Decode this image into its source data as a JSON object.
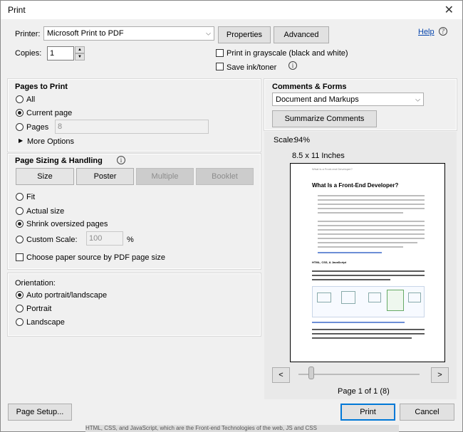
{
  "window": {
    "title": "Print",
    "close_glyph": "✕"
  },
  "printer": {
    "label": "Printer:",
    "selected": "Microsoft Print to PDF",
    "properties_label": "Properties",
    "advanced_label": "Advanced",
    "help_label": "Help"
  },
  "copies": {
    "label": "Copies:",
    "value": "1"
  },
  "options": {
    "grayscale_label": "Print in grayscale (black and white)",
    "grayscale_checked": false,
    "save_ink_label": "Save ink/toner",
    "save_ink_checked": false
  },
  "pages_to_print": {
    "heading": "Pages to Print",
    "all_label": "All",
    "current_label": "Current page",
    "pages_label": "Pages",
    "pages_value": "8",
    "selected": "Current page",
    "more_options_label": "More Options"
  },
  "sizing": {
    "heading": "Page Sizing & Handling",
    "buttons": [
      "Size",
      "Poster",
      "Multiple",
      "Booklet"
    ],
    "fit_label": "Fit",
    "actual_label": "Actual size",
    "shrink_label": "Shrink oversized pages",
    "custom_label": "Custom Scale:",
    "custom_value": "100",
    "percent": "%",
    "selected": "Shrink oversized pages",
    "paper_source_label": "Choose paper source by PDF page size"
  },
  "orientation": {
    "heading": "Orientation:",
    "auto_label": "Auto portrait/landscape",
    "portrait_label": "Portrait",
    "landscape_label": "Landscape",
    "selected": "Auto portrait/landscape"
  },
  "comments": {
    "heading": "Comments & Forms",
    "selected": "Document and Markups",
    "summarize_label": "Summarize Comments"
  },
  "preview": {
    "scale_label": "Scale:",
    "scale_value": "94%",
    "paper_size": "8.5 x 11 Inches",
    "page_header": "What is a Front-end Developer?",
    "page_title": "What Is a Front-End Developer?",
    "page_subheading": "HTML, CSS, & JavaScript",
    "prev_label": "<",
    "next_label": ">",
    "page_indicator": "Page 1 of 1 (8)"
  },
  "footer": {
    "page_setup_label": "Page Setup...",
    "print_label": "Print",
    "cancel_label": "Cancel"
  },
  "background_text": "HTML, CSS, and JavaScript, which are the Front-end Technologies of the web, JS and CSS"
}
